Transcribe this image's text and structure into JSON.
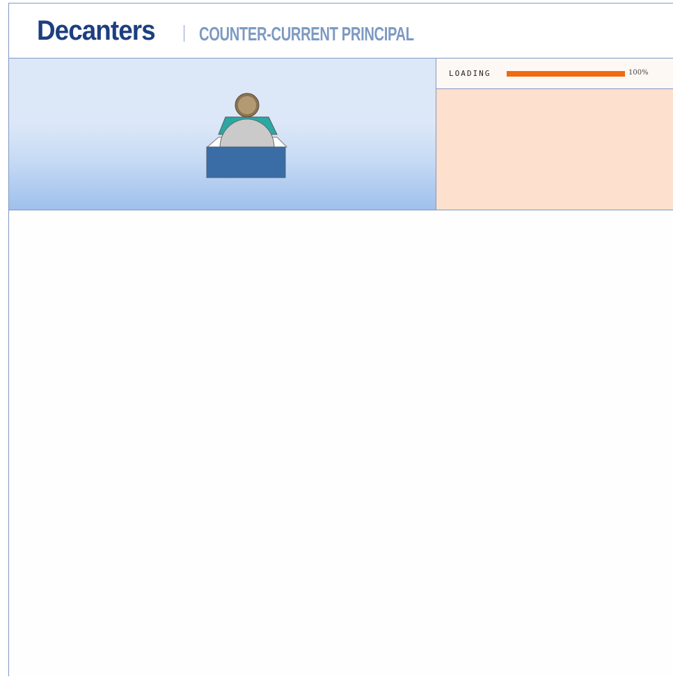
{
  "header": {
    "brand": "Decanters",
    "subtitle": "COUNTER-CURRENT PRINCIPAL"
  },
  "hero": {
    "illustration": "person-at-desk-icon"
  },
  "loader": {
    "label": "LOADING",
    "progress": 1.0,
    "percent_text": "100%",
    "bar_color": "#f06a0f"
  },
  "colors": {
    "brand": "#1d3f7f",
    "subtitle": "#7d9ac2",
    "hero_top": "#dce8f8",
    "hero_bottom": "#9fc0ec",
    "side_panel": "#fde0cd",
    "border": "#7f98c4"
  }
}
